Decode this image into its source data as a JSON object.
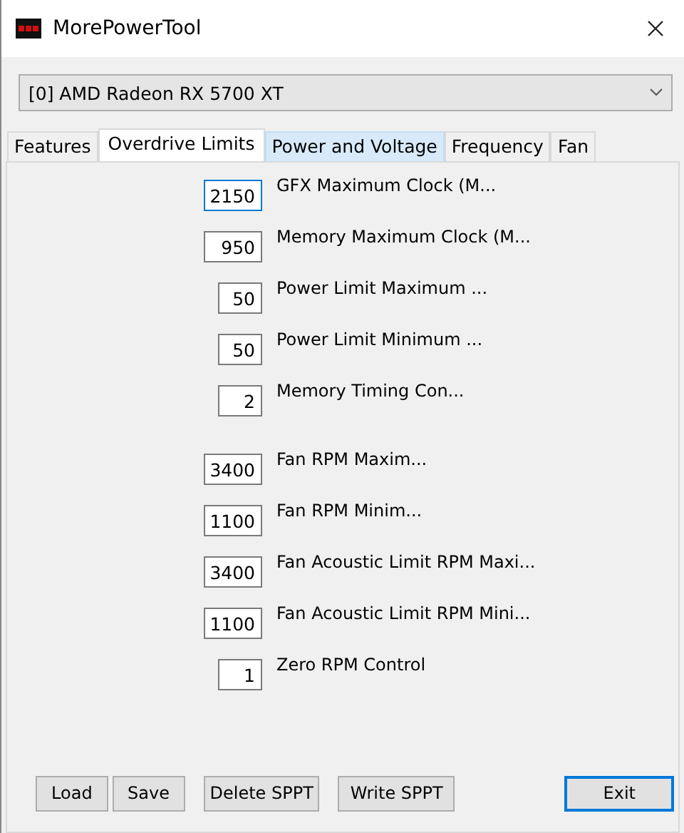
{
  "window": {
    "title": "MorePowerTool"
  },
  "device_select": {
    "value": "[0] AMD Radeon RX 5700 XT"
  },
  "tabs": [
    {
      "label": "Features",
      "selected": false,
      "hovered": false
    },
    {
      "label": "Overdrive Limits",
      "selected": true,
      "hovered": false
    },
    {
      "label": "Power and Voltage",
      "selected": false,
      "hovered": true
    },
    {
      "label": "Frequency",
      "selected": false,
      "hovered": false
    },
    {
      "label": "Fan",
      "selected": false,
      "hovered": false
    }
  ],
  "groups": [
    [
      {
        "value": "2150",
        "label": "GFX Maximum Clock (M...",
        "kind": "wide",
        "focused": true
      },
      {
        "value": "950",
        "label": "Memory Maximum Clock (M...",
        "kind": "wide",
        "focused": false
      },
      {
        "value": "50",
        "label": "Power Limit Maximum ...",
        "kind": "narrow",
        "focused": false
      },
      {
        "value": "50",
        "label": "Power Limit Minimum ...",
        "kind": "narrow",
        "focused": false
      },
      {
        "value": "2",
        "label": "Memory Timing Con...",
        "kind": "narrow",
        "focused": false
      }
    ],
    [
      {
        "value": "3400",
        "label": "Fan RPM Maxim...",
        "kind": "wide",
        "focused": false
      },
      {
        "value": "1100",
        "label": "Fan RPM Minim...",
        "kind": "wide",
        "focused": false
      },
      {
        "value": "3400",
        "label": "Fan Acoustic Limit RPM Maxi...",
        "kind": "wide",
        "focused": false
      },
      {
        "value": "1100",
        "label": "Fan Acoustic Limit RPM Mini...",
        "kind": "wide",
        "focused": false
      },
      {
        "value": "1",
        "label": "Zero RPM Control",
        "kind": "narrow",
        "focused": false
      }
    ]
  ],
  "buttons": [
    {
      "label": "Load",
      "default": false
    },
    {
      "label": "Save",
      "default": false
    },
    {
      "label": "Delete SPPT",
      "default": false
    },
    {
      "label": "Write SPPT",
      "default": false
    },
    {
      "label": "Exit",
      "default": true
    }
  ]
}
